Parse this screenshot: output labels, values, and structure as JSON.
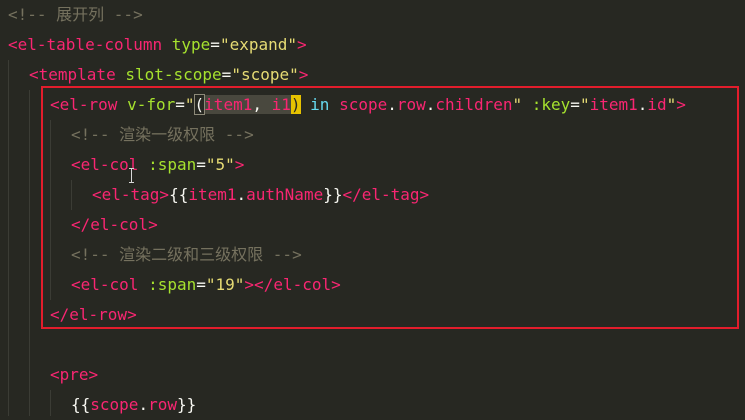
{
  "editor": {
    "lines": [
      {
        "tokens": [
          {
            "cls": "c",
            "text": "<!-- 展开列 -->"
          }
        ]
      },
      {
        "tokens": [
          {
            "cls": "t",
            "text": "<el-table-column"
          },
          {
            "cls": "w",
            "text": " "
          },
          {
            "cls": "a",
            "text": "type"
          },
          {
            "cls": "w",
            "text": "="
          },
          {
            "cls": "s",
            "text": "\"expand\""
          },
          {
            "cls": "t",
            "text": ">"
          }
        ]
      },
      {
        "tokens": [
          {
            "cls": "t",
            "text": "<template"
          },
          {
            "cls": "w",
            "text": " "
          },
          {
            "cls": "a",
            "text": "slot-scope"
          },
          {
            "cls": "w",
            "text": "="
          },
          {
            "cls": "s",
            "text": "\"scope\""
          },
          {
            "cls": "t",
            "text": ">"
          }
        ]
      },
      {
        "tokens": [
          {
            "cls": "t",
            "text": "<el-row"
          },
          {
            "cls": "w",
            "text": " "
          },
          {
            "cls": "a",
            "text": "v-for"
          },
          {
            "cls": "w",
            "text": "="
          },
          {
            "cls": "s",
            "text": "\""
          },
          {
            "cls": "w brk",
            "text": "("
          },
          {
            "cls": "t sel",
            "text": "item1"
          },
          {
            "cls": "w sel",
            "text": ", "
          },
          {
            "cls": "t sel",
            "text": "i1"
          },
          {
            "cls": "w cursor-box",
            "text": ")"
          },
          {
            "cls": "w",
            "text": " "
          },
          {
            "cls": "m",
            "text": "in"
          },
          {
            "cls": "w",
            "text": " "
          },
          {
            "cls": "t",
            "text": "scope"
          },
          {
            "cls": "w",
            "text": "."
          },
          {
            "cls": "t",
            "text": "row"
          },
          {
            "cls": "w",
            "text": "."
          },
          {
            "cls": "t",
            "text": "children"
          },
          {
            "cls": "s",
            "text": "\""
          },
          {
            "cls": "w",
            "text": " "
          },
          {
            "cls": "a",
            "text": ":key"
          },
          {
            "cls": "w",
            "text": "="
          },
          {
            "cls": "s",
            "text": "\""
          },
          {
            "cls": "t",
            "text": "item1"
          },
          {
            "cls": "w",
            "text": "."
          },
          {
            "cls": "t",
            "text": "id"
          },
          {
            "cls": "s",
            "text": "\""
          },
          {
            "cls": "t",
            "text": ">"
          }
        ]
      },
      {
        "tokens": [
          {
            "cls": "c",
            "text": "<!-- 渲染一级权限 -->"
          }
        ]
      },
      {
        "tokens": [
          {
            "cls": "t",
            "text": "<el-col"
          },
          {
            "cls": "w",
            "text": " "
          },
          {
            "cls": "a",
            "text": ":span"
          },
          {
            "cls": "w",
            "text": "="
          },
          {
            "cls": "s",
            "text": "\"5\""
          },
          {
            "cls": "t",
            "text": ">"
          }
        ]
      },
      {
        "tokens": [
          {
            "cls": "t",
            "text": "<el-tag>"
          },
          {
            "cls": "w",
            "text": "{{"
          },
          {
            "cls": "t",
            "text": "item1"
          },
          {
            "cls": "w",
            "text": "."
          },
          {
            "cls": "t",
            "text": "authName"
          },
          {
            "cls": "w",
            "text": "}}"
          },
          {
            "cls": "t",
            "text": "</el-tag>"
          }
        ]
      },
      {
        "tokens": [
          {
            "cls": "t",
            "text": "</el-col>"
          }
        ]
      },
      {
        "tokens": [
          {
            "cls": "c",
            "text": "<!-- 渲染二级和三级权限 -->"
          }
        ]
      },
      {
        "tokens": [
          {
            "cls": "t",
            "text": "<el-col"
          },
          {
            "cls": "w",
            "text": " "
          },
          {
            "cls": "a",
            "text": ":span"
          },
          {
            "cls": "w",
            "text": "="
          },
          {
            "cls": "s",
            "text": "\"19\""
          },
          {
            "cls": "t",
            "text": "></el-col>"
          }
        ]
      },
      {
        "tokens": [
          {
            "cls": "t",
            "text": "</el-row>"
          }
        ]
      },
      {
        "tokens": []
      },
      {
        "tokens": [
          {
            "cls": "t",
            "text": "<pre>"
          }
        ]
      },
      {
        "tokens": [
          {
            "cls": "w",
            "text": "{{"
          },
          {
            "cls": "t",
            "text": "scope"
          },
          {
            "cls": "w",
            "text": "."
          },
          {
            "cls": "t",
            "text": "row"
          },
          {
            "cls": "w",
            "text": "}}"
          }
        ]
      }
    ]
  },
  "colors": {
    "background": "#272822",
    "comment": "#75715e",
    "tag": "#f92672",
    "attribute": "#a6e22e",
    "string": "#e6db74",
    "keyword": "#66d9ef",
    "highlight_border": "#e21d2c",
    "cursor_box": "#e6c200"
  }
}
